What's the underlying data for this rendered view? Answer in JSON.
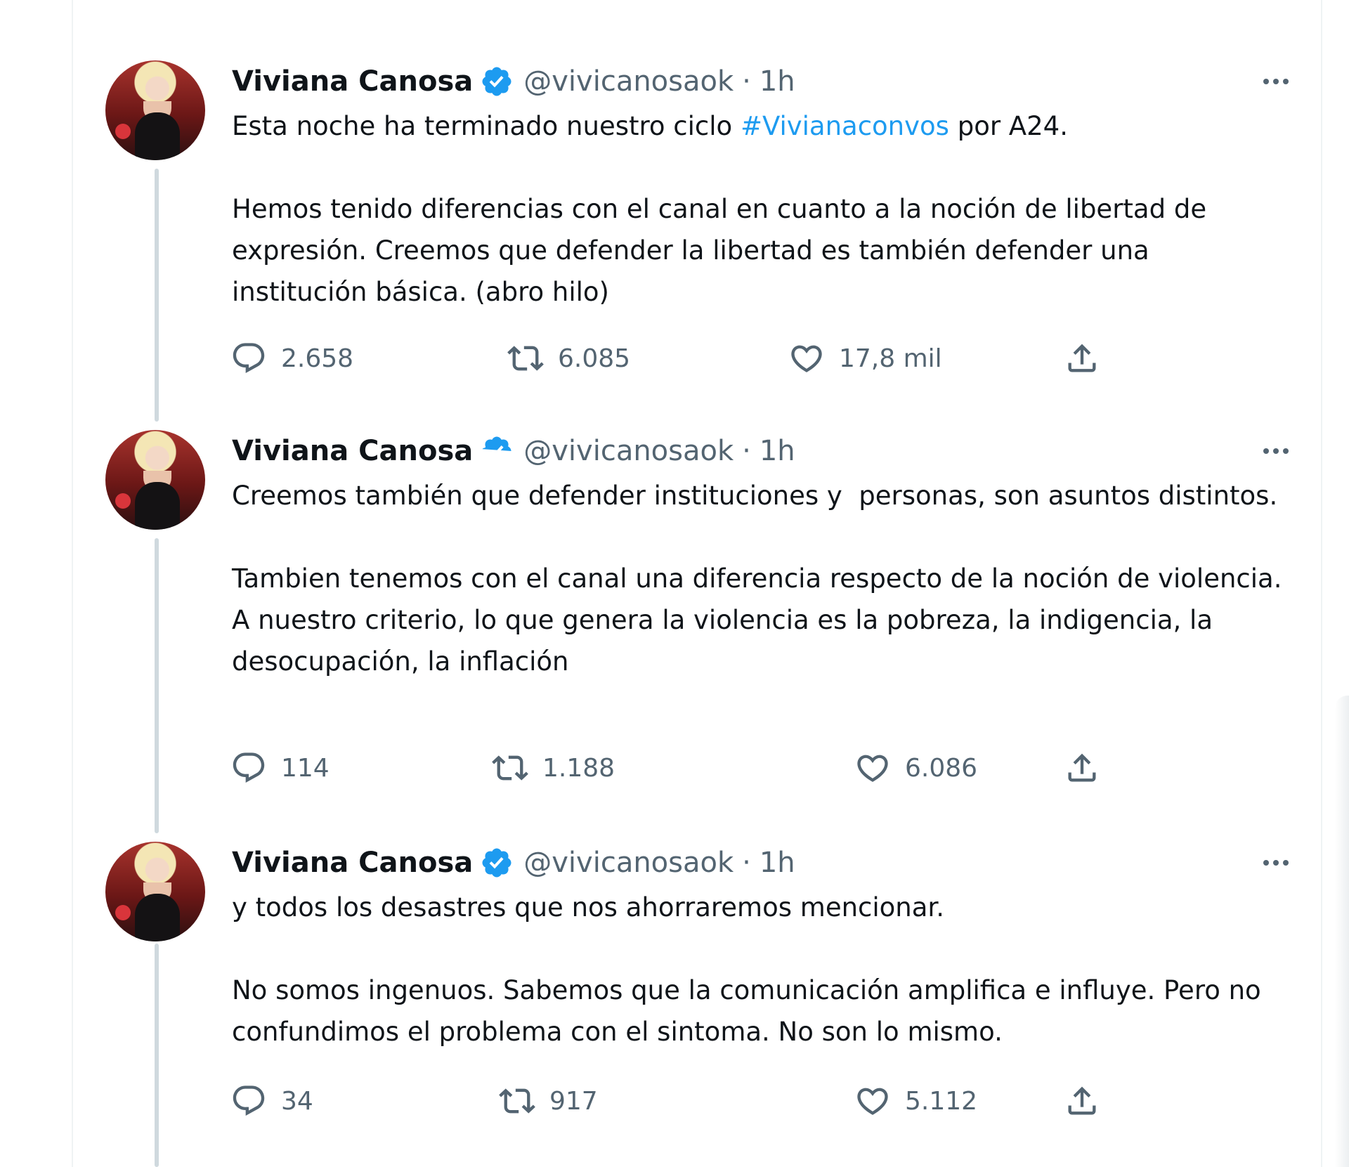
{
  "tweets": [
    {
      "name": "Viviana Canosa",
      "handle": "@vivicanosaok",
      "separator": "·",
      "time": "1h",
      "text_before_hashtag": "Esta noche ha terminado nuestro ciclo ",
      "hashtag": "#Vivianaconvos",
      "text_after_hashtag": " por A24.\n\nHemos tenido diferencias con el canal en cuanto a la noción de libertad de expresión. Creemos que defender la libertad es también defender una institución básica. (abro hilo)",
      "replies": "2.658",
      "retweets": "6.085",
      "likes": "17,8 mil"
    },
    {
      "name": "Viviana Canosa",
      "handle": "@vivicanosaok",
      "separator": "·",
      "time": "1h",
      "text": "Creemos también que defender instituciones y  personas, son asuntos distintos.\n\nTambien tenemos con el canal una diferencia respecto de la noción de violencia. A nuestro criterio, lo que genera la violencia es la pobreza, la indigencia, la desocupación, la inflación",
      "replies": "114",
      "retweets": "1.188",
      "likes": "6.086"
    },
    {
      "name": "Viviana Canosa",
      "handle": "@vivicanosaok",
      "separator": "·",
      "time": "1h",
      "text": "y todos los desastres que nos ahorraremos mencionar.\n\nNo somos ingenuos. Sabemos que la comunicación amplifica e influye. Pero no confundimos el problema con el sintoma. No son lo mismo.",
      "replies": "34",
      "retweets": "917",
      "likes": "5.112"
    }
  ],
  "icons": {
    "reply": "reply-icon",
    "retweet": "retweet-icon",
    "like": "heart-icon",
    "share": "share-icon",
    "verified": "verified-badge-icon",
    "more": "more-options-icon"
  },
  "colors": {
    "text": "#0f1419",
    "secondary": "#536471",
    "link": "#1d9bf0",
    "verified": "#1d9bf0",
    "thread_line": "#cfd9de"
  }
}
